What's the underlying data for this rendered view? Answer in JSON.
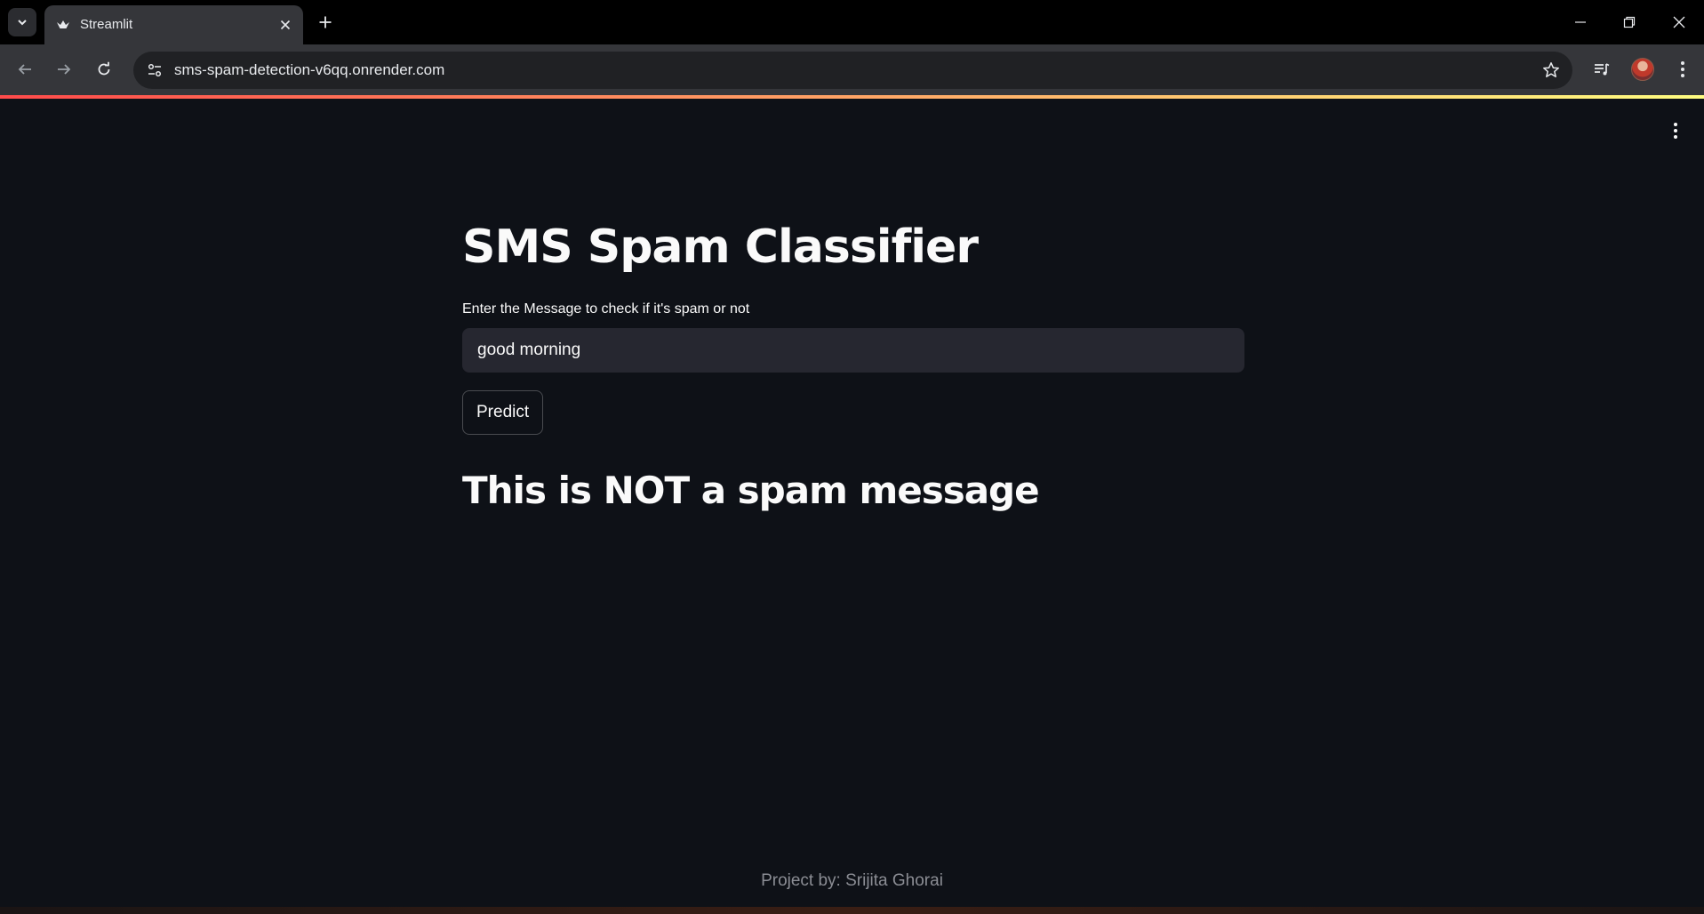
{
  "browser": {
    "tab_title": "Streamlit",
    "url": "sms-spam-detection-v6qq.onrender.com",
    "icons": {
      "tab_search": "chevron-down-icon",
      "favicon": "streamlit-crown-icon",
      "tab_close": "close-icon",
      "new_tab": "plus-icon",
      "back": "arrow-left-icon",
      "forward": "arrow-right-icon",
      "reload": "reload-icon",
      "site_info": "tune-icon",
      "bookmark": "star-icon",
      "media": "media-queue-icon",
      "menu": "kebab-menu-icon",
      "minimize": "minimize-icon",
      "restore": "restore-icon",
      "close_window": "close-icon"
    }
  },
  "app": {
    "title": "SMS Spam Classifier",
    "input_label": "Enter the Message to check if it's spam or not",
    "input_value": "good morning",
    "button_label": "Predict",
    "result": "This is NOT a spam message",
    "footer": "Project by: Srijita Ghorai",
    "colors": {
      "background": "#0e1117",
      "input_bg": "#262730",
      "text": "#fafafa",
      "footer_text": "#8b8d94",
      "accent_start": "#ff4b4b",
      "accent_end": "#fffd80"
    }
  }
}
